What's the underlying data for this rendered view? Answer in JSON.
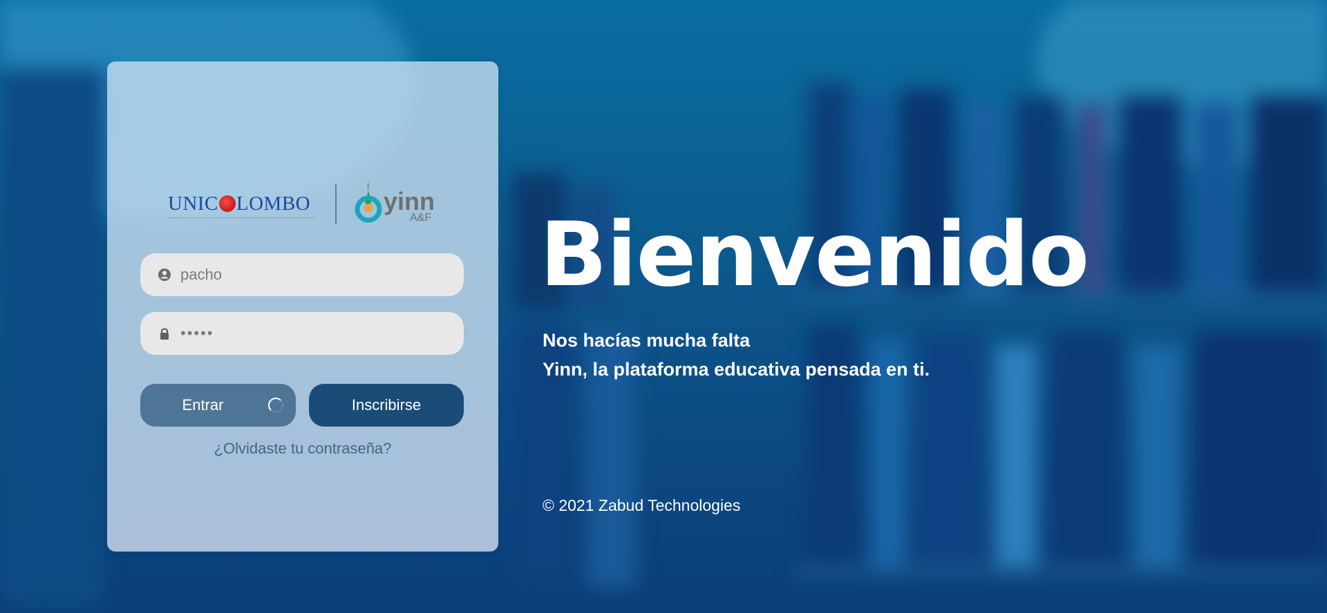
{
  "login": {
    "username_value": "pacho",
    "password_masked": "•••••",
    "enter_label": "Entrar",
    "signup_label": "Inscribirse",
    "forgot_label": "¿Olvidaste tu contraseña?"
  },
  "logos": {
    "partner_left": "UNIC",
    "partner_right": "LOMBO",
    "brand": "yinn",
    "brand_sub": "A&F"
  },
  "hero": {
    "title": "Bienvenido",
    "line1": "Nos hacías mucha falta",
    "line2": "Yinn, la plataforma educativa pensada en ti."
  },
  "footer": {
    "copyright": "© 2021 Zabud Technologies"
  },
  "icons": {
    "user": "user-circle-icon",
    "lock": "lock-icon",
    "loading": "spinner-icon"
  },
  "colors": {
    "primary": "#1b4c78",
    "enter_button": "#4f7596",
    "link": "#3f6688",
    "background": "#0b5a8e"
  }
}
